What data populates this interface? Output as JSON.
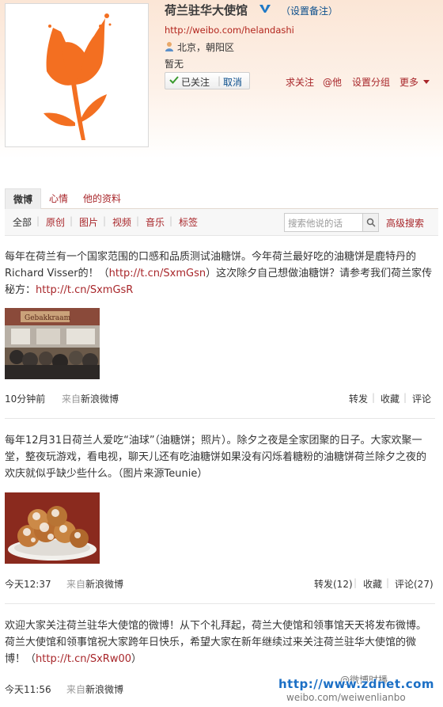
{
  "profile": {
    "name": "荷兰驻华大使馆",
    "set_remark": "（设置备注）",
    "url": "http://weibo.com/helandashi",
    "location": "北京，朝阳区",
    "bio": "暂无",
    "followed": "已关注",
    "follow_sep": "|",
    "unfollow": "取消",
    "actions": [
      "求关注",
      "@他",
      "设置分组",
      "更多"
    ]
  },
  "tabs": [
    "微博",
    "心情",
    "他的资料"
  ],
  "filters": [
    "全部",
    "原创",
    "图片",
    "视频",
    "音乐",
    "标签"
  ],
  "filter_sep": "|",
  "search": {
    "placeholder": "搜索他说的话",
    "advanced": "高级搜索"
  },
  "posts": [
    {
      "text_1": "每年在荷兰有一个国家范围的口感和品质测试油糖饼。今年荷兰最好吃的油糖饼是鹿特丹的Richard Visser的！（",
      "link_1": "http://t.cn/SxmGsn",
      "text_2": "）这次除夕自己想做油糖饼？请参考我们荷兰家传秘方：",
      "link_2": "http://t.cn/SxmGsR",
      "image_sign": "Gebakkraam",
      "time": "10分钟前",
      "from": "来自",
      "source": "新浪微博",
      "repost": "转发",
      "favorite": "收藏",
      "comment": "评论"
    },
    {
      "text_1": "每年12月31日荷兰人爱吃“油球”（油糖饼；照片）。除夕之夜是全家团聚的日子。大家欢聚一堂，整夜玩游戏，看电视，聊天儿还有吃油糖饼如果没有闪烁着糖粉的油糖饼荷兰除夕之夜的欢庆就似乎缺少些什么。（图片来源Teunie）",
      "time": "今天12:37",
      "from": "来自",
      "source": "新浪微博",
      "repost": "转发(12)",
      "favorite": "收藏",
      "comment": "评论(27)"
    },
    {
      "text_1": "欢迎大家关注荷兰驻华大使馆的微博！从下个礼拜起，荷兰大使馆和领事馆天天将发布微博。荷兰大使馆和领事馆祝大家跨年日快乐，希望大家在新年继续过来关注荷兰驻华大使馆的微博！（",
      "link_1": "http://t.cn/SxRw00",
      "text_2": "）",
      "time": "今天11:56",
      "from": "来自",
      "source": "新浪微博"
    }
  ],
  "watermark": {
    "url": "http://www.zdnet.com",
    "weibo": "@微博时播",
    "handle": "weibo.com/weiwenlianbo"
  },
  "colors": {
    "accent": "#a8262a",
    "link_blue": "#0a4e8c",
    "header_bg": "#fbe6d6",
    "logo_orange": "#f36f21"
  }
}
